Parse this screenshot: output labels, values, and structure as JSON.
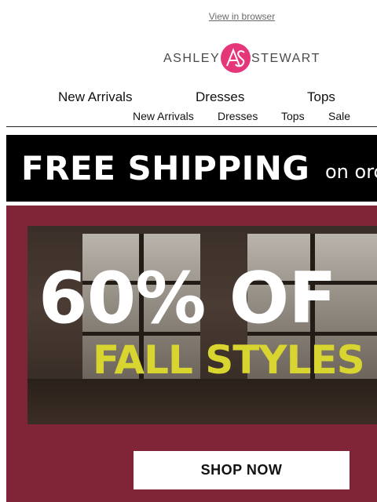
{
  "header": {
    "view_in_browser": "View in browser",
    "logo": {
      "left": "ASHLEY",
      "monogram": "AS",
      "right": "STEWART",
      "accent_color": "#e6367a"
    }
  },
  "nav_primary": [
    "New Arrivals",
    "Dresses",
    "Tops"
  ],
  "nav_secondary": [
    "New Arrivals",
    "Dresses",
    "Tops",
    "Sale"
  ],
  "shipping_banner": {
    "headline": "FREE SHIPPING",
    "tail": "on orc"
  },
  "promo": {
    "background_color": "#802438",
    "headline": "60% OF",
    "subhead": "FALL STYLES",
    "subhead_color": "#d8d530",
    "cta_label": "SHOP NOW"
  }
}
